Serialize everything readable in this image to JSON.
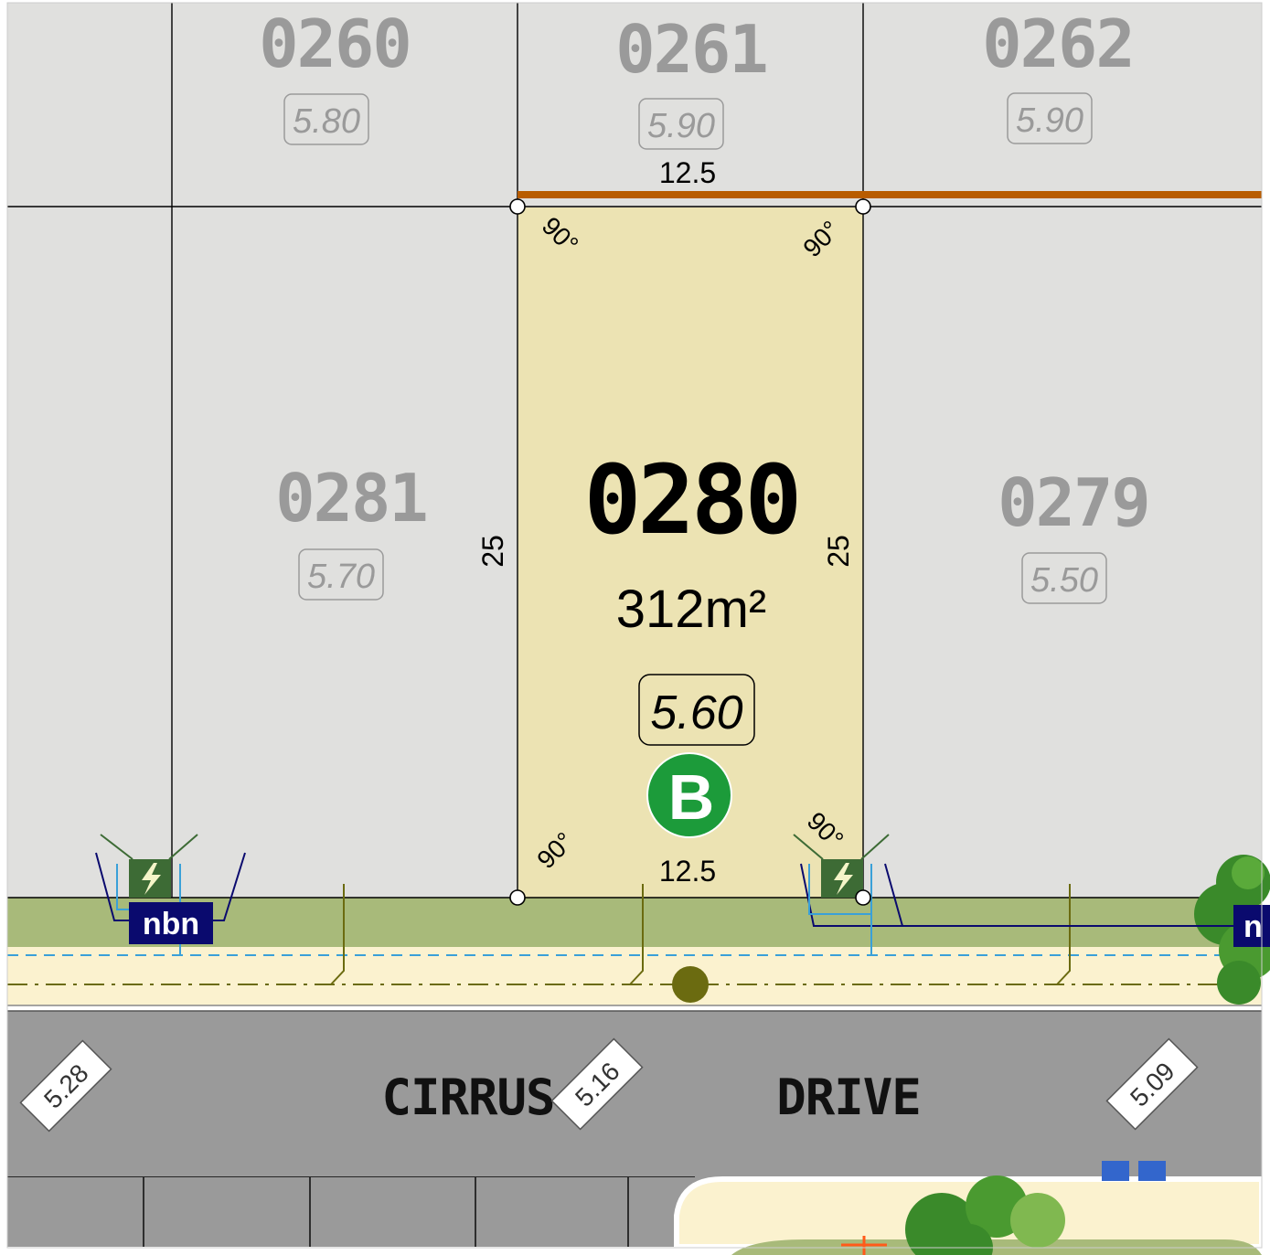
{
  "lots": {
    "lot_0260": {
      "number": "0260",
      "level": "5.80"
    },
    "lot_0261": {
      "number": "0261",
      "level": "5.90"
    },
    "lot_0262": {
      "number": "0262",
      "level": "5.90"
    },
    "lot_0281": {
      "number": "0281",
      "level": "5.70"
    },
    "lot_0279": {
      "number": "0279",
      "level": "5.50"
    },
    "lot_0280": {
      "number": "0280",
      "area": "312m²",
      "level": "5.60",
      "badge": "B",
      "frontage_top": "12.5",
      "frontage_bottom": "12.5",
      "depth_left": "25",
      "depth_right": "25",
      "corner_angle": "90°"
    }
  },
  "road": {
    "name_part1": "CIRRUS",
    "name_part2": "DRIVE",
    "levels": [
      "5.28",
      "5.16",
      "5.09"
    ]
  },
  "services": {
    "nbn_label": "nbn",
    "nbn_label_cut": "n"
  },
  "colors": {
    "selected_lot_fill": "#ece3b3",
    "other_lot_fill": "#e0e0de",
    "verge_green": "#a8ba7a",
    "footpath": "#fbf2cf",
    "road": "#9a9a9a",
    "retaining_wall": "#b85c00",
    "badge_green": "#1c9b3a",
    "nbn_navy": "#0a0a6e",
    "power_pit": "#3d6b35"
  }
}
